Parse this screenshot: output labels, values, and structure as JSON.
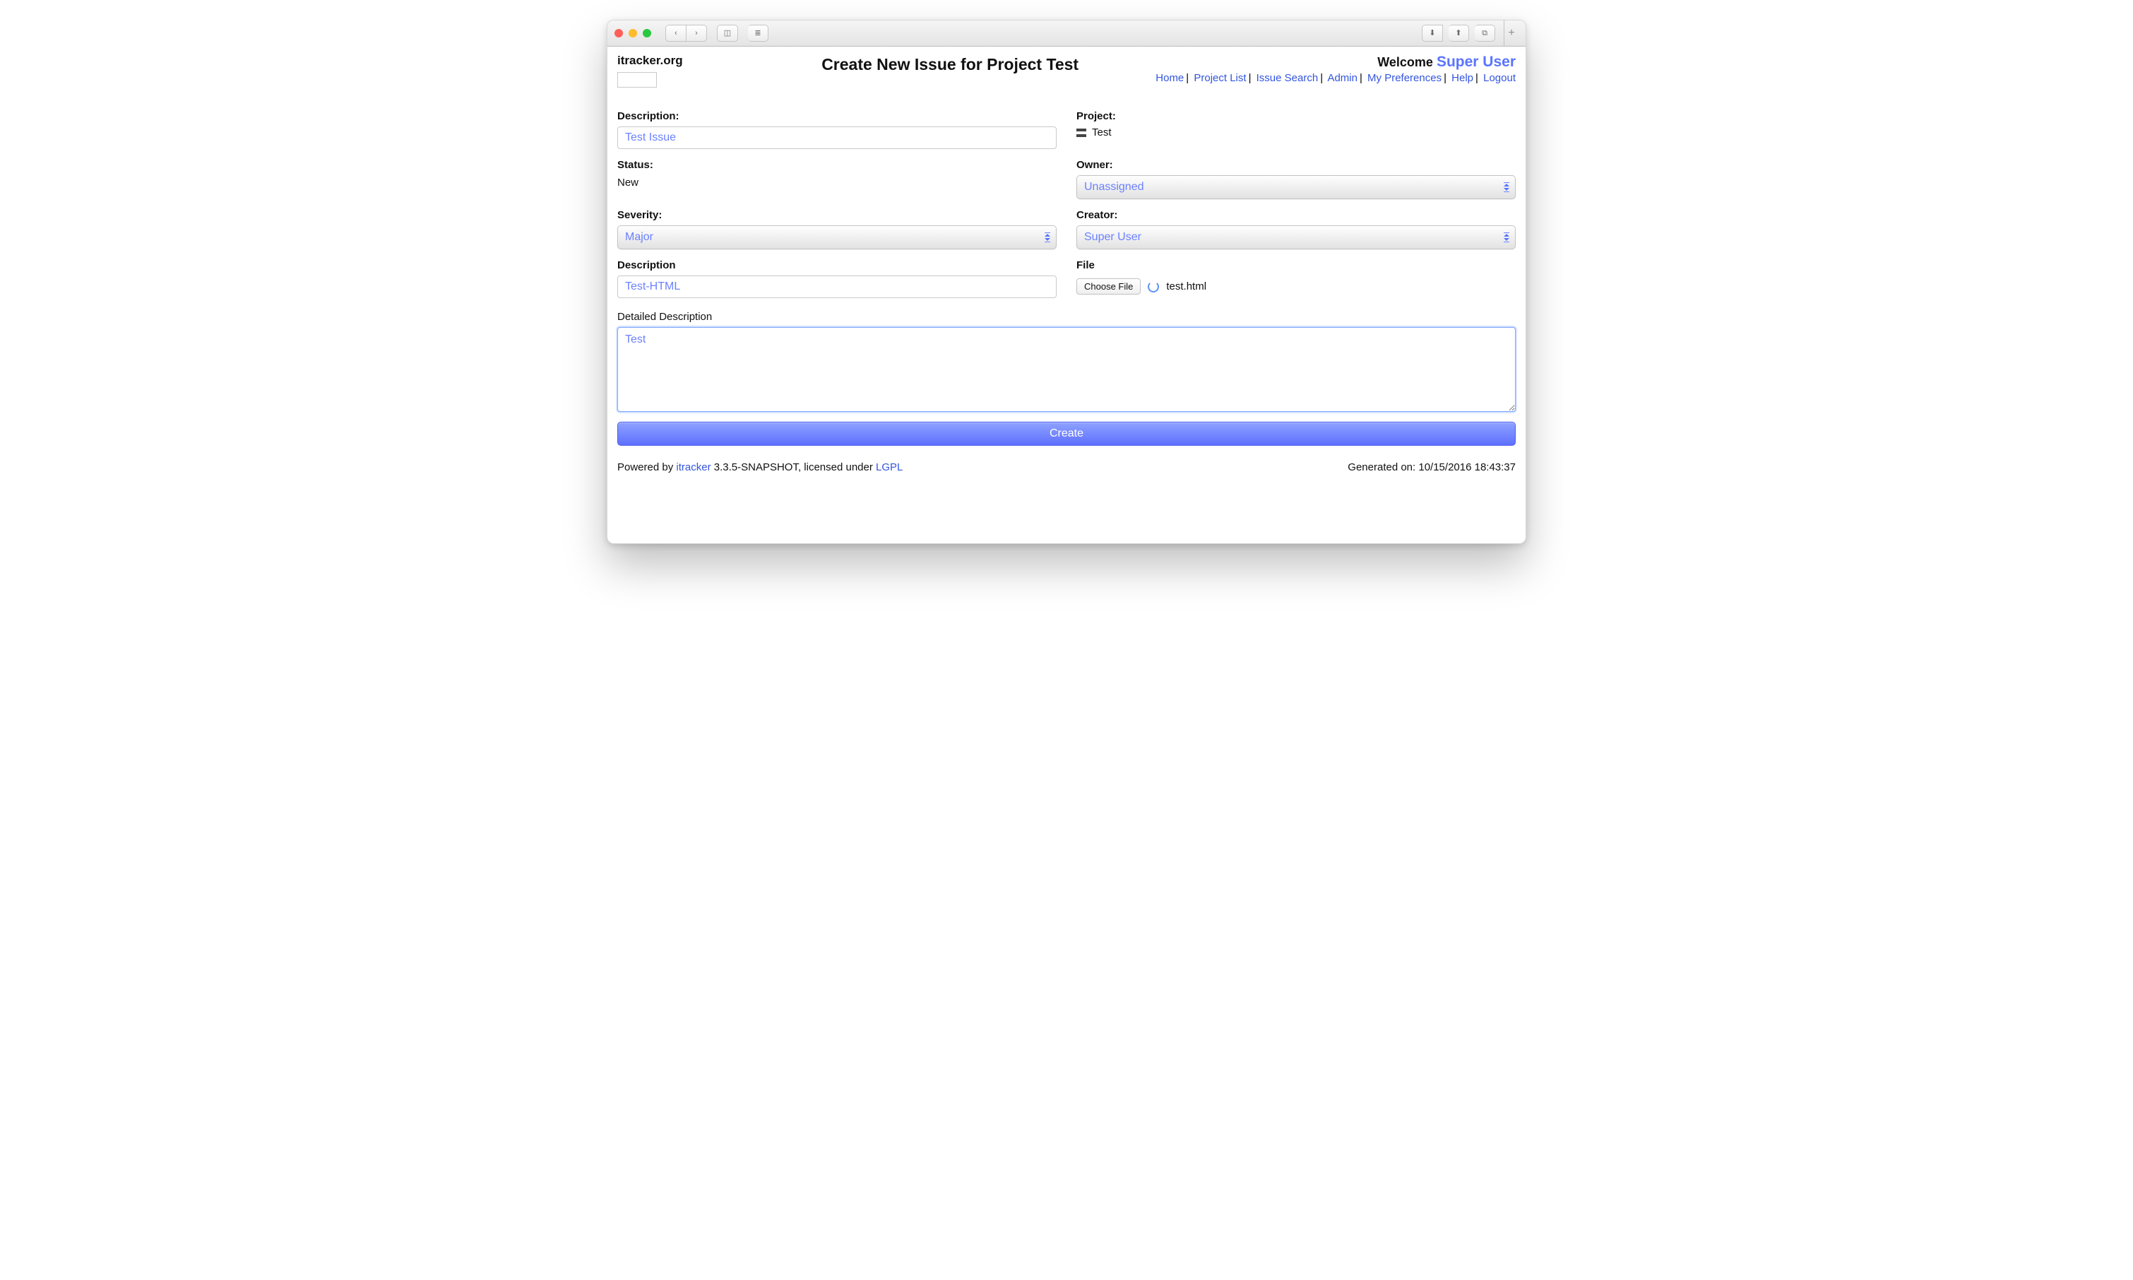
{
  "site": {
    "brand": "itracker.org"
  },
  "page": {
    "title": "Create New Issue for Project Test"
  },
  "user": {
    "welcome_label": "Welcome",
    "name": "Super User"
  },
  "nav": {
    "home": "Home",
    "project_list": "Project List",
    "issue_search": "Issue Search",
    "admin": "Admin",
    "my_preferences": "My Preferences",
    "help": "Help",
    "logout": "Logout",
    "sep": "|"
  },
  "form": {
    "description_label": "Description:",
    "description_value": "Test Issue",
    "status_label": "Status:",
    "status_value": "New",
    "severity_label": "Severity:",
    "severity_value": "Major",
    "description2_label": "Description",
    "description2_value": "Test-HTML",
    "project_label": "Project:",
    "project_value": "Test",
    "owner_label": "Owner:",
    "owner_value": "Unassigned",
    "creator_label": "Creator:",
    "creator_value": "Super User",
    "file_label": "File",
    "choose_file_label": "Choose File",
    "file_name": "test.html",
    "detailed_label": "Detailed Description",
    "detailed_value": "Test",
    "submit_label": "Create"
  },
  "footer": {
    "powered_by_prefix": "Powered by ",
    "product": "itracker",
    "version_suffix": " 3.3.5-SNAPSHOT, licensed under ",
    "license": "LGPL",
    "generated_label": "Generated on: ",
    "generated_value": "10/15/2016 18:43:37"
  },
  "icons": {
    "back": "‹",
    "forward": "›",
    "sidebar": "◫",
    "reader": "≣",
    "download": "⬇",
    "share": "⬆",
    "tabs": "⧉",
    "plus": "+"
  }
}
